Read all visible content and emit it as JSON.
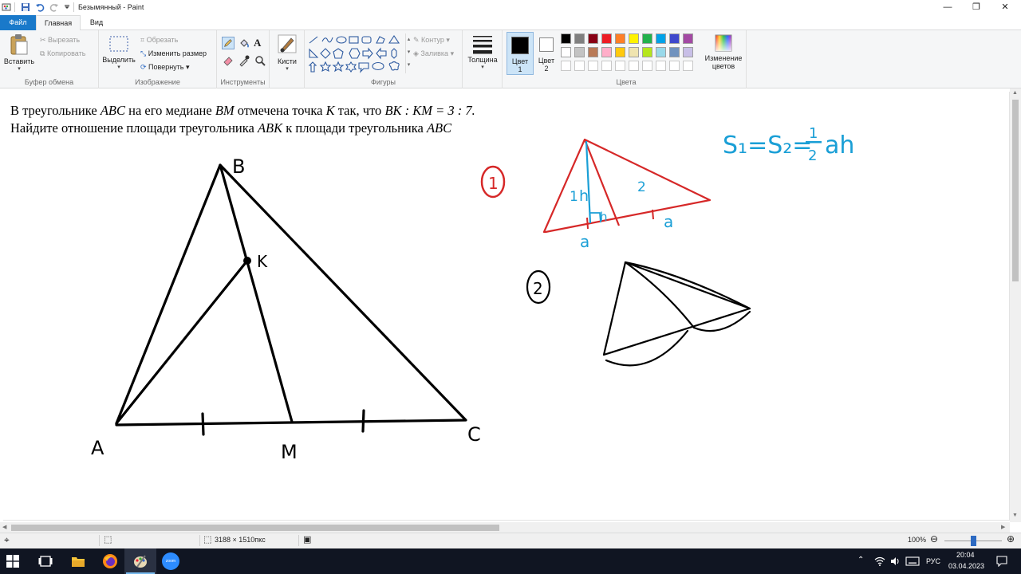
{
  "window": {
    "title": "Безымянный - Paint",
    "controls": {
      "minimize": "—",
      "maximize": "❐",
      "close": "✕"
    }
  },
  "tabs": [
    {
      "label": "Файл"
    },
    {
      "label": "Главная"
    },
    {
      "label": "Вид"
    }
  ],
  "ribbon": {
    "clipboard": {
      "group_label": "Буфер обмена",
      "paste": "Вставить",
      "cut": "Вырезать",
      "copy": "Копировать"
    },
    "image": {
      "group_label": "Изображение",
      "select": "Выделить",
      "crop": "Обрезать",
      "resize": "Изменить размер",
      "rotate": "Повернуть"
    },
    "tools": {
      "group_label": "Инструменты",
      "text_tool": "A"
    },
    "brushes": {
      "label": "Кисти"
    },
    "shapes": {
      "group_label": "Фигуры",
      "outline": "Контур",
      "fill": "Заливка"
    },
    "size": {
      "label": "Толщина"
    },
    "color1": {
      "label_line1": "Цвет",
      "label_line2": "1",
      "color": "#000000"
    },
    "color2": {
      "label_line1": "Цвет",
      "label_line2": "2",
      "color": "#ffffff"
    },
    "colors": {
      "group_label": "Цвета",
      "edit_line1": "Изменение",
      "edit_line2": "цветов",
      "palette_row1": [
        "#000000",
        "#7f7f7f",
        "#880015",
        "#ed1c24",
        "#ff7f27",
        "#fff200",
        "#22b14c",
        "#00a2e8",
        "#3f48cc",
        "#a349a4"
      ],
      "palette_row2": [
        "#ffffff",
        "#c3c3c3",
        "#b97a57",
        "#ffaec9",
        "#ffc90e",
        "#efe4b0",
        "#b5e61d",
        "#99d9ea",
        "#7092be",
        "#c8bfe7"
      ]
    }
  },
  "canvas": {
    "problem": {
      "line1_a": "В треугольнике ",
      "line1_abc": "ABC",
      "line1_b": " на его медиане ",
      "line1_bm": "BM",
      "line1_c": " отмечена точка ",
      "line1_k": "K",
      "line1_d": " так, что ",
      "line1_ratio": "BK : KM = 3 : 7.",
      "line2_a": "Найдите отношение площади треугольника ",
      "line2_abk": "ABK",
      "line2_b": " к площади треугольника ",
      "line2_abc": "ABC"
    },
    "handwriting": {
      "vertex_b": "B",
      "point_k": "K",
      "vertex_a": "A",
      "point_m": "M",
      "vertex_c": "C",
      "circle1": "1",
      "label_1": "1",
      "label_h1": "h",
      "label_h2": "h",
      "label_2": "2",
      "label_a1": "a",
      "label_a2": "a",
      "formula": "S₁=S₂=",
      "frac_num": "1",
      "frac_den": "2",
      "formula_tail": "ah",
      "circle2": "2"
    }
  },
  "statusbar": {
    "dimensions": "3188 × 1510пкс",
    "zoom": "100%",
    "zoom_slider_level": 0.5
  },
  "taskbar": {
    "lang": "РУС",
    "time": "20:04",
    "date": "03.04.2023",
    "app_zoom_label": "zoom"
  }
}
